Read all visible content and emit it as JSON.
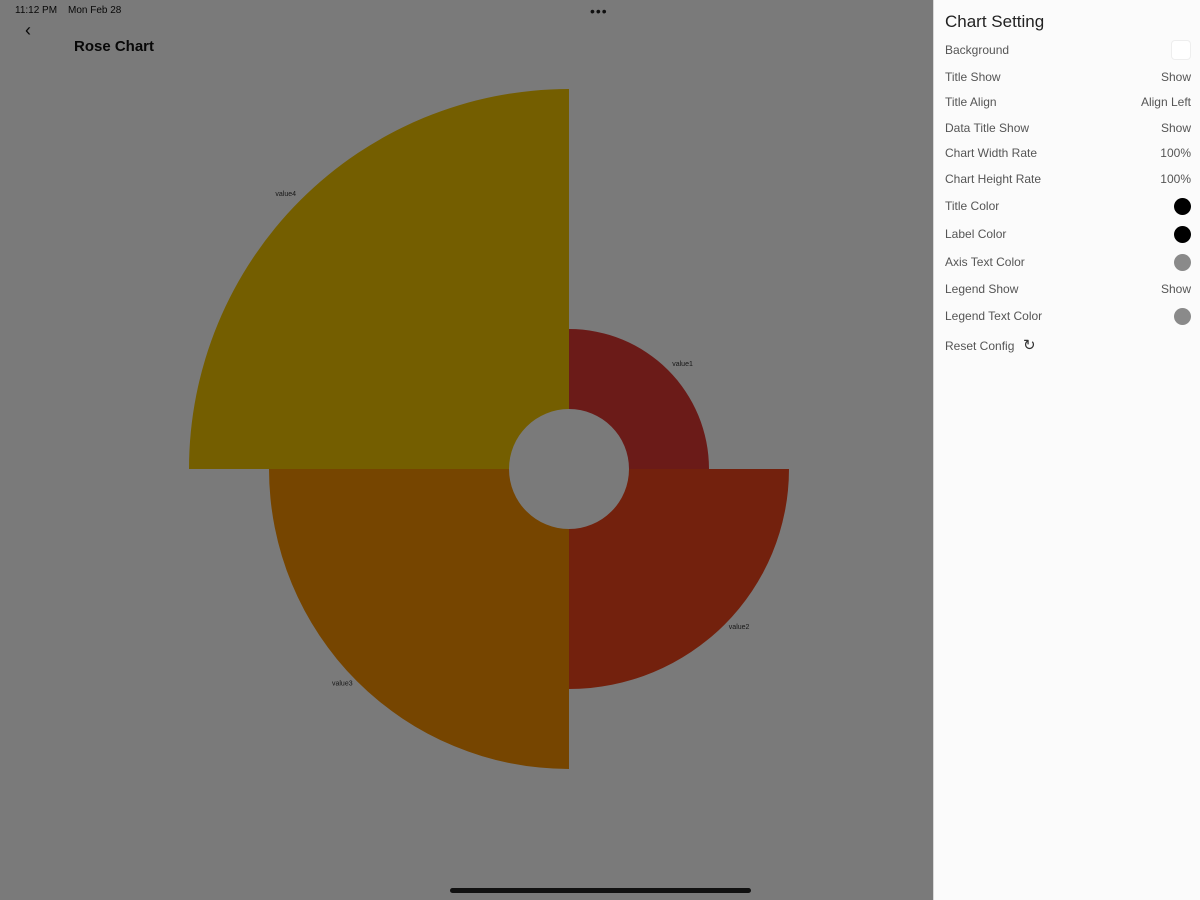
{
  "status_bar": {
    "time": "11:12 PM",
    "date": "Mon Feb 28",
    "dots": "•••"
  },
  "app": {
    "back_icon": "chevron-left-icon",
    "back_glyph": "‹",
    "title": "Rose Chart"
  },
  "chart_data": {
    "type": "rose",
    "title": "",
    "categories": [
      "value1",
      "value2",
      "value3",
      "value4"
    ],
    "values": [
      140,
      220,
      300,
      380
    ],
    "colors": [
      "#e03a33",
      "#f0461c",
      "#f79000",
      "#f3c400"
    ],
    "inner_radius": 60,
    "legend": "none"
  },
  "settings": {
    "title": "Chart Setting",
    "rows": [
      {
        "label": "Background",
        "type": "swatch-square",
        "color": "#ffffff"
      },
      {
        "label": "Title Show",
        "type": "text",
        "value": "Show"
      },
      {
        "label": "Title Align",
        "type": "text",
        "value": "Align Left"
      },
      {
        "label": "Data Title Show",
        "type": "text",
        "value": "Show"
      },
      {
        "label": "Chart Width Rate",
        "type": "text",
        "value": "100%"
      },
      {
        "label": "Chart Height Rate",
        "type": "text",
        "value": "100%"
      },
      {
        "label": "Title Color",
        "type": "swatch",
        "color": "#000000"
      },
      {
        "label": "Label Color",
        "type": "swatch",
        "color": "#000000"
      },
      {
        "label": "Axis Text Color",
        "type": "swatch",
        "color": "#8a8a8a"
      },
      {
        "label": "Legend Show",
        "type": "text",
        "value": "Show"
      },
      {
        "label": "Legend Text Color",
        "type": "swatch",
        "color": "#8a8a8a"
      }
    ],
    "reset": {
      "label": "Reset Config",
      "icon": "reset-icon",
      "glyph": "↻"
    }
  }
}
